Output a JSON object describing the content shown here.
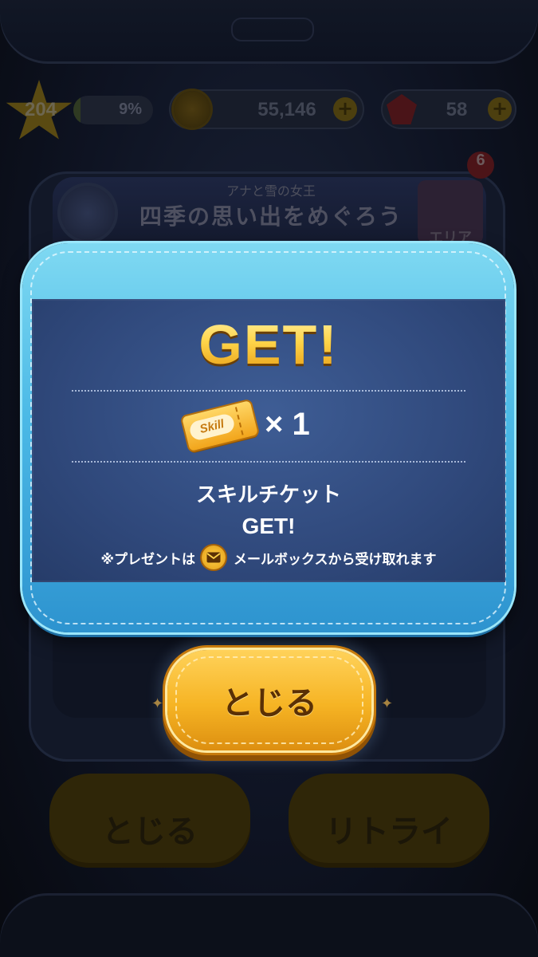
{
  "hud": {
    "level": "204",
    "exp_percent_label": "9%",
    "exp_progress": 0.09,
    "coins": "55,146",
    "rubies": "58"
  },
  "event": {
    "subtitle": "アナと雪の女王",
    "title": "四季の思い出をめぐろう",
    "area_label": "エリア",
    "badge_count": "6"
  },
  "background_buttons": {
    "close_label": "とじる",
    "retry_label": "リトライ"
  },
  "reward_dialog": {
    "title": "GET!",
    "ticket_label": "Skill",
    "quantity": "× 1",
    "item_name": "スキルチケット",
    "item_get": "GET!",
    "notice_prefix": "※プレゼントは",
    "notice_suffix": "メールボックスから受け取れます",
    "close_button_label": "とじる"
  },
  "colors": {
    "dialog_frame": "#4bb9e6",
    "dialog_panel": "#30497c",
    "title_gold": "#ffd54a",
    "button_gold": "#f6b424",
    "button_text": "#5a3005"
  }
}
